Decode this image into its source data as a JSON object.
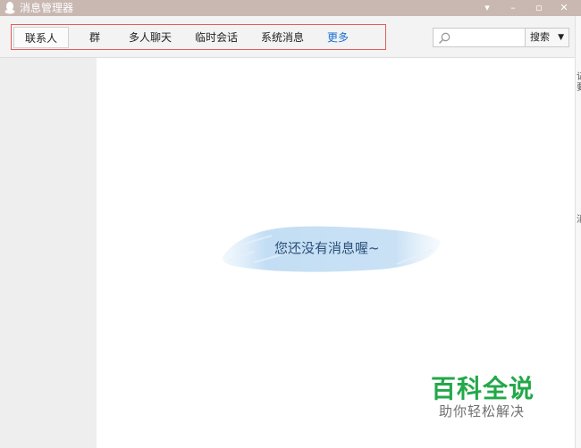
{
  "window": {
    "title": "消息管理器",
    "controls": {
      "dropdown": "▾",
      "minimize": "–",
      "maximize": "▫",
      "close": "✕"
    }
  },
  "toolbar": {
    "tabs": [
      {
        "label": "联系人"
      },
      {
        "label": "群"
      },
      {
        "label": "多人聊天"
      },
      {
        "label": "临时会话"
      },
      {
        "label": "系统消息"
      },
      {
        "label": "更多"
      }
    ],
    "search": {
      "placeholder": "",
      "button_label": "搜索",
      "button_arrow": "▼"
    }
  },
  "main": {
    "empty_message": "您还没有消息喔~"
  },
  "edge": {
    "fragments": [
      "记",
      "要",
      "消"
    ]
  },
  "watermark": {
    "title": "百科全说",
    "subtitle": "助你轻松解决"
  },
  "colors": {
    "titlebar": "#c9b8b2",
    "highlight_border": "#e65a5a",
    "link_blue": "#1a6fcf",
    "empty_text": "#2b4f79",
    "watermark_green": "#23a84a"
  }
}
